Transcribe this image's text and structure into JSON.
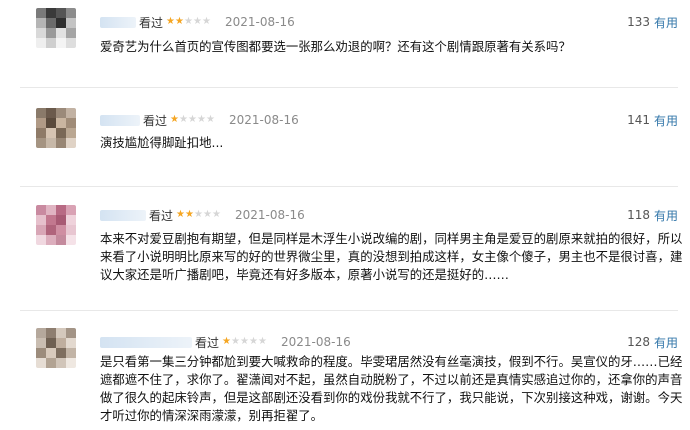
{
  "labels": {
    "seen": "看过",
    "useful": "有用"
  },
  "colors": {
    "star_on": "#f5a623",
    "star_off": "#d6d6d6",
    "link": "#3377aa"
  },
  "reviews": [
    {
      "status": "看过",
      "rating": 2,
      "date": "2021-08-16",
      "votes": "133",
      "votes_label": "有用",
      "lines": [
        "爱奇艺为什么首页的宣传图都要选一张那么劝退的啊？还有这个剧情跟原著有关系吗？"
      ]
    },
    {
      "status": "看过",
      "rating": 1,
      "date": "2021-08-16",
      "votes": "141",
      "votes_label": "有用",
      "lines": [
        "演技尴尬得脚趾扣地..."
      ]
    },
    {
      "status": "看过",
      "rating": 2,
      "date": "2021-08-16",
      "votes": "118",
      "votes_label": "有用",
      "lines": [
        "本来不对爱豆剧抱有期望，但是同样是木浮生小说改编的剧，同样男主角是爱豆的剧原来就拍的很好，所以",
        "来看了小说明明比原来写的好的世界微尘里，真的没想到拍成这样，女主像个傻子，男主也不是很讨喜，建",
        "议大家还是听广播剧吧，毕竟还有好多版本，原著小说写的还是挺好的……"
      ]
    },
    {
      "status": "看过",
      "rating": 1,
      "date": "2021-08-16",
      "votes": "128",
      "votes_label": "有用",
      "lines": [
        "是只看第一集三分钟都尬到要大喊救命的程度。毕雯珺居然没有丝毫演技，假到不行。吴宣仪的牙……已经",
        "遮都遮不住了，求你了。翟潇闻对不起，虽然自动脱粉了，不过以前还是真情实感追过你的，还拿你的声音",
        "做了很久的起床铃声，但是这部剧还没看到你的戏份我就不行了，我只能说，下次别接这种戏，谢谢。今天",
        "才听过你的情深深雨濛濛，别再拒翟了。"
      ]
    }
  ]
}
